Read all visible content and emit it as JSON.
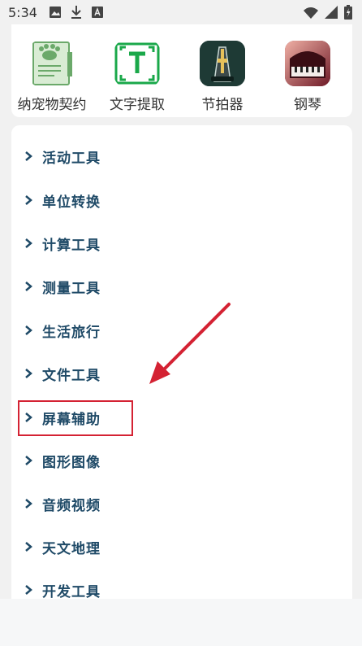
{
  "status_bar": {
    "time": "5:34",
    "icons": [
      "image-icon",
      "download-icon",
      "a-badge-icon",
      "wifi-icon",
      "signal-icon",
      "battery-charging-icon"
    ]
  },
  "apps": [
    {
      "label": "纳宠物契约",
      "icon": "pet-contract-icon",
      "color": "#d9ecd4"
    },
    {
      "label": "文字提取",
      "icon": "text-extract-icon",
      "color": "#1aa84a"
    },
    {
      "label": "节拍器",
      "icon": "metronome-icon",
      "color": "#1f3a33"
    },
    {
      "label": "钢琴",
      "icon": "piano-icon",
      "color": "#7a1f2c"
    }
  ],
  "tool_categories": [
    "活动工具",
    "单位转换",
    "计算工具",
    "测量工具",
    "生活旅行",
    "文件工具",
    "屏幕辅助",
    "图形图像",
    "音频视频",
    "天文地理",
    "开发工具"
  ],
  "colors": {
    "list_text": "#1f4a67",
    "annotation": "#d42233"
  }
}
